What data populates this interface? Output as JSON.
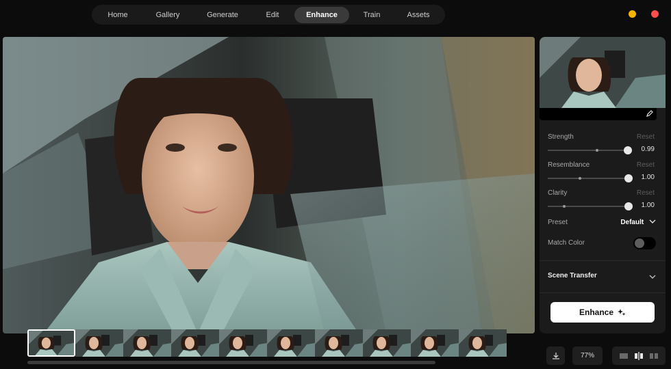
{
  "nav": {
    "items": [
      "Home",
      "Gallery",
      "Generate",
      "Edit",
      "Enhance",
      "Train",
      "Assets"
    ],
    "active": "Enhance"
  },
  "window_controls": {
    "minimize_color": "#f5b400",
    "close_color": "#ff4d4d"
  },
  "filmstrip": {
    "count": 10,
    "selected_index": 0
  },
  "panel": {
    "sliders": [
      {
        "label": "Strength",
        "reset": "Reset",
        "value": "0.99",
        "fraction": 0.99
      },
      {
        "label": "Resemblance",
        "reset": "Reset",
        "value": "1.00",
        "fraction": 1.0
      },
      {
        "label": "Clarity",
        "reset": "Reset",
        "value": "1.00",
        "fraction": 1.0
      }
    ],
    "preset": {
      "label": "Preset",
      "value": "Default"
    },
    "match_color": {
      "label": "Match Color",
      "enabled": false
    },
    "scene_transfer": {
      "label": "Scene Transfer"
    },
    "enhance_button": "Enhance"
  },
  "toolbar": {
    "zoom": "77%"
  },
  "colors": {
    "accent": "#ffffff",
    "panel_bg": "#1b1b1b",
    "app_bg": "#0c0c0c"
  }
}
